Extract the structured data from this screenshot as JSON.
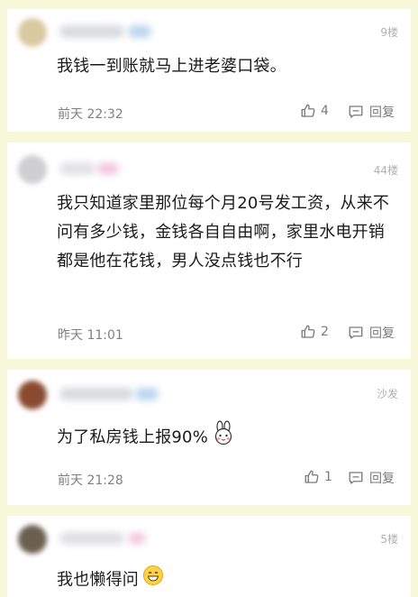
{
  "comments": [
    {
      "floor": "9楼",
      "text": "我钱一到账就马上进老婆口袋。",
      "time": "前天 22:32",
      "likes": "4",
      "reply_label": "回复",
      "avatar_color": "#d9c9a0",
      "name_color": "#d8dae0",
      "badge_color": "#bcd6f0"
    },
    {
      "floor": "44楼",
      "text": "我只知道家里那位每个月20号发工资，从来不问有多少钱，金钱各自自由啊，家里水电开销都是他在花钱，男人没点钱也不行",
      "time": "昨天 11:01",
      "likes": "2",
      "reply_label": "回复",
      "avatar_color": "#cfcfd2",
      "name_color": "#e2e2e6",
      "badge_color": "#f3c9e0"
    },
    {
      "floor": "沙发",
      "text": "为了私房钱上报90%",
      "time": "前天 21:28",
      "likes": "1",
      "reply_label": "回复",
      "avatar_color": "#8a4a30",
      "name_color": "#d8dadf",
      "badge_color": "#bcd6f0"
    },
    {
      "floor": "5楼",
      "text": "我也懒得问",
      "avatar_color": "#6b6050",
      "name_color": "#e0e0e4",
      "badge_color": "#f3cde2"
    }
  ],
  "icons": {
    "like": "thumbs-up-icon",
    "reply": "comment-icon",
    "rabbit_emoji": "rabbit-emoji-icon",
    "grin_emoji": "grin-emoji-icon"
  },
  "colors": {
    "background": "#f6f8d9",
    "card": "#ffffff",
    "text": "#1a1a1a",
    "meta": "#808080"
  }
}
